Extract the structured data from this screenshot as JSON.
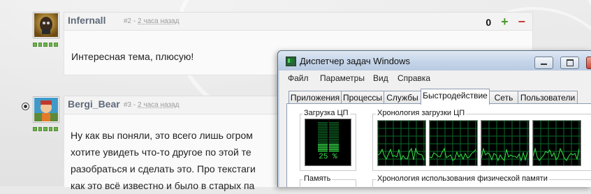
{
  "post1": {
    "author": "Infernall",
    "number": "#2",
    "separator": "-",
    "time": "2 часа назад",
    "score": "0",
    "plus_symbol": "+",
    "minus_symbol": "−",
    "text": "Интересная тема, плюсую!",
    "rank_dots": 5
  },
  "post2": {
    "author": "Bergi_Bear",
    "number": "#3",
    "separator": "-",
    "time": "2 часа назад",
    "rank_dots": 5,
    "lines": [
      "Ну как вы поняли, это всего лишь огром",
      "хотите увидеть что-то другое по этой те",
      "разобраться и сделать это. Про текстаги",
      "как это всё известно и было в старых па"
    ]
  },
  "taskmanager": {
    "title": "Диспетчер задач Windows",
    "menu": [
      "Файл",
      "Параметры",
      "Вид",
      "Справка"
    ],
    "tabs": [
      "Приложения",
      "Процессы",
      "Службы",
      "Быстродействие",
      "Сеть",
      "Пользователи"
    ],
    "active_tab": "Быстродействие",
    "cpu_label": "Загрузка ЦП",
    "cpu_value": "25 %",
    "cpu_fraction": 0.25,
    "cpu_history_label": "Хронология загрузки ЦП",
    "memory_label": "Память",
    "memory_history_label": "Хронология использования физической памяти"
  },
  "colors": {
    "graph_line": "#35e44a",
    "grid": "#0b6b2a",
    "plus": "#4a9a2e",
    "minus": "#c63a32"
  }
}
